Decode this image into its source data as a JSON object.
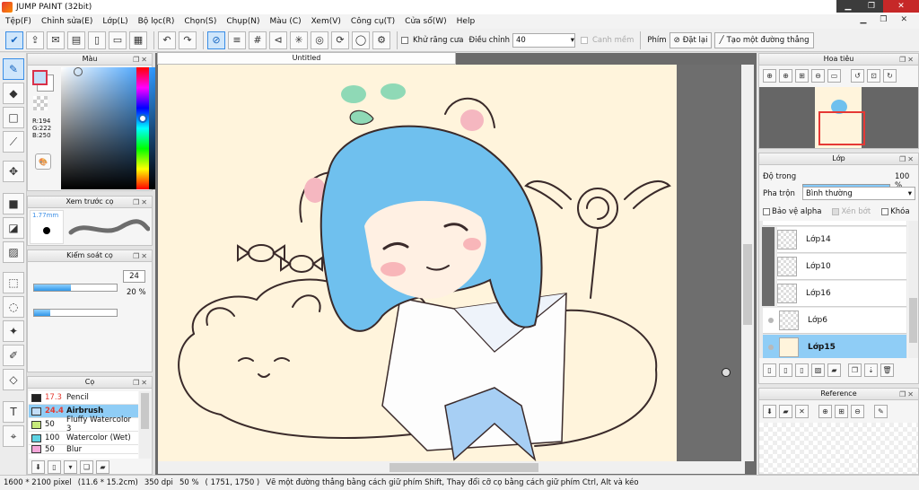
{
  "window": {
    "title": "JUMP PAINT (32bit)",
    "min": "▁",
    "max": "❐",
    "close": "✕"
  },
  "menu": [
    "Tệp(F)",
    "Chỉnh sửa(E)",
    "Lớp(L)",
    "Bộ lọc(R)",
    "Chọn(S)",
    "Chụp(N)",
    "Màu (C)",
    "Xem(V)",
    "Công cụ(T)",
    "Cửa sổ(W)",
    "Help"
  ],
  "doc_controls": {
    "min": "▁",
    "restore": "❐",
    "close": "✕"
  },
  "toolbar": {
    "antialias_label": "Khử răng cưa",
    "adjust_label": "Điều chỉnh",
    "adjust_value": "40",
    "smooth_label": "Canh mềm",
    "key_label": "Phím",
    "reset_label": "Đặt lại",
    "line_label": "Tạo một đường thẳng"
  },
  "color_panel": {
    "title": "Màu",
    "r": "R:194",
    "g": "G:222",
    "b": "B:250",
    "fg": "#c2def9",
    "bg": "#ffffff"
  },
  "brush_preview": {
    "title": "Xem trước cọ",
    "size": "1.77mm"
  },
  "brush_control": {
    "title": "Kiểm soát cọ",
    "size_value": "24",
    "opacity_value": "20",
    "opacity_unit": "%",
    "size_fraction": 0.45,
    "opacity_fraction": 0.2
  },
  "brush_list": {
    "title": "Cọ",
    "items": [
      {
        "size": "17.3",
        "name": "Pencil",
        "color": "#222222",
        "selected": false
      },
      {
        "size": "24.4",
        "name": "Airbrush",
        "color": "#c2def9",
        "selected": true
      },
      {
        "size": "50",
        "name": "Fluffy Watercolor 3",
        "color": "#c6e97a",
        "selected": false
      },
      {
        "size": "100",
        "name": "Watercolor (Wet)",
        "color": "#5fd3e3",
        "selected": false
      },
      {
        "size": "50",
        "name": "Blur",
        "color": "#f4a6d9",
        "selected": false
      }
    ]
  },
  "canvas": {
    "tab": "Untitled"
  },
  "navigator": {
    "title": "Hoa tiêu"
  },
  "layers": {
    "title": "Lớp",
    "opacity_label": "Độ trong",
    "opacity_value": "100",
    "opacity_unit": "%",
    "opacity_fraction": 1.0,
    "blend_label": "Pha trộn",
    "blend_value": "Bình thường",
    "protect_alpha": "Bảo vệ alpha",
    "clipping": "Xén bớt",
    "lock": "Khóa",
    "items": [
      {
        "name": "Lớp14",
        "selected": false
      },
      {
        "name": "Lớp10",
        "selected": false
      },
      {
        "name": "Lớp16",
        "selected": false
      },
      {
        "name": "Lớp6",
        "selected": false
      },
      {
        "name": "Lớp15",
        "selected": true
      }
    ]
  },
  "reference": {
    "title": "Reference"
  },
  "status": {
    "pixels": "1600 * 2100 pixel",
    "size_cm": "(11.6 * 15.2cm)",
    "dpi": "350 dpi",
    "zoom": "50 %",
    "coords": "( 1751, 1750 )",
    "hint": "Vẽ một đường thẳng bằng cách giữ phím Shift, Thay đổi cỡ cọ bằng cách giữ phím Ctrl, Alt và kéo"
  },
  "colors": {
    "accent": "#3a8ee6",
    "selection": "#8fcdf6",
    "paper": "#fff4dc",
    "hair": "#6fc0ee"
  }
}
